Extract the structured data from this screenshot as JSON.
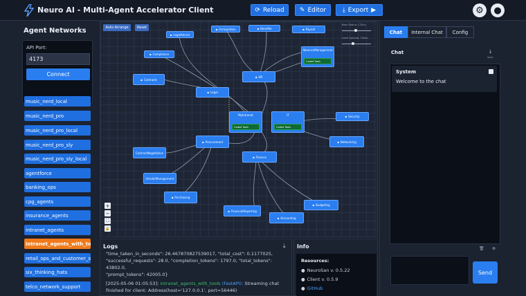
{
  "header": {
    "title": "Neuro AI - Multi-Agent Accelerator Client",
    "reload_label": "Reload",
    "editor_label": "Editor",
    "export_label": "Export"
  },
  "sidebar": {
    "title": "Agent Networks",
    "port_label": "API Port:",
    "port_value": "4173",
    "connect_label": "Connect",
    "networks": [
      "music_nerd_local",
      "music_nerd_pro",
      "music_nerd_pro_local",
      "music_nerd_pro_sly",
      "music_nerd_pro_sly_local",
      "agentforce",
      "banking_ops",
      "cpg_agents",
      "insurance_agents",
      "intranet_agents",
      "intranet_agents_with_tools",
      "retail_ops_and_customer_service",
      "six_thinking_hats",
      "telco_network_support"
    ],
    "active_network": "intranet_agents_with_tools"
  },
  "graph": {
    "auto_arrange_label": "Auto Arrange",
    "reset_label": "Reset",
    "slider_radius_label": "Base Radius: 135px",
    "slider_spacing_label": "Level Spacing: 100px",
    "zoom_in": "+",
    "zoom_out": "−",
    "fit": "⛶",
    "lock": "🔒",
    "nodes": {
      "legal_advice": "LegalAdvice",
      "immigration": "Immigration",
      "benefits": "Benefits",
      "payroll": "Payroll",
      "compliance": "Compliance",
      "absence_mgmt": "AbsenceManagement",
      "contracts": "Contracts",
      "hr": "HR",
      "legal": "Legal",
      "myintranet": "MyIntranet",
      "it": "IT",
      "security": "Security",
      "networking": "Networking",
      "procurement": "Procurement",
      "contract_negotiation": "ContractNegotiation",
      "finance": "Finance",
      "vendor_mgmt": "VendorManagement",
      "purchasing": "Purchasing",
      "budgeting": "Budgeting",
      "financial_reporting": "FinancialReporting",
      "accounting": "Accounting",
      "coded_tools": "Coded Tools"
    }
  },
  "logs": {
    "title": "Logs",
    "line1": "\"time_taken_in_seconds\": 26.467870827539017, \"total_cost\": 0.1177025,",
    "line2": "\"successful_requests\": 28.0, \"completion_tokens\": 1797.0, \"total_tokens\": 43802.0,",
    "line3": "\"prompt_tokens\": 42005.0}",
    "line4_time": "[2025-05-06 01:05:53]:",
    "line4_source": "intranet_agents_with_tools",
    "line4_api": "(FastAPI):",
    "line4_rest": "Streaming chat finished for client: Address(host='127.0.0.1', port=56446)"
  },
  "info": {
    "title": "Info",
    "resources_label": "Resources:",
    "neurosan": "NeuroSan v. 0.5.22",
    "client": "Client v. 0.5.9",
    "github": "GitHub"
  },
  "chat": {
    "tabs": [
      "Chat",
      "Internal Chat",
      "Config"
    ],
    "panel_title": "Chat",
    "save_label": "Save",
    "sender": "System",
    "message": "Welcome to the chat",
    "send_label": "Send",
    "input_value": ""
  },
  "colors": {
    "accent": "#2a7ef0",
    "active_item": "#f07a1a",
    "coded_tools": "#0f6a33"
  }
}
